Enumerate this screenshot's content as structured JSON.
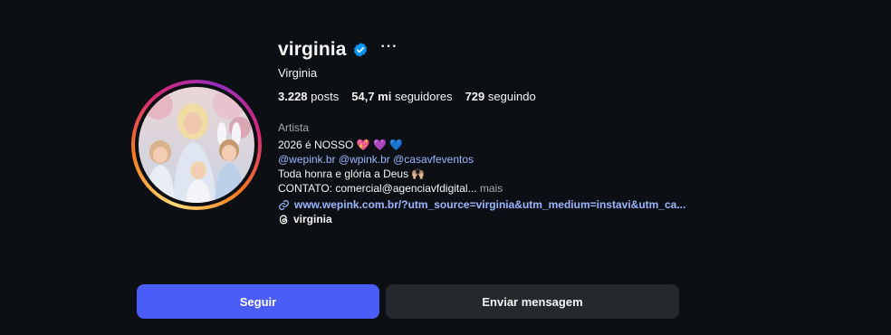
{
  "profile": {
    "username": "virginia",
    "full_name": "Virginia",
    "verified": true,
    "avatar_alt": "virginia"
  },
  "stats": {
    "posts_count": "3.228",
    "posts_label": "posts",
    "followers_count": "54,7 mi",
    "followers_label": "seguidores",
    "following_count": "729",
    "following_label": "seguindo"
  },
  "bio": {
    "category": "Artista",
    "line1": "2026 é NOSSO 💖 💜 💙",
    "mentions": [
      "@wepink.br",
      "@wpink.br",
      "@casavfeventos"
    ],
    "line3": "Toda honra e glória a Deus 🙌🏼",
    "line4": "CONTATO: comercial@agenciavfdigital...",
    "more_label": "mais",
    "link": "www.wepink.com.br/?utm_source=virginia&utm_medium=instavi&utm_ca...",
    "threads_handle": "virginia"
  },
  "actions": {
    "follow_label": "Seguir",
    "message_label": "Enviar mensagem"
  },
  "colors": {
    "background": "#0c1014",
    "follow_button": "#4a5df9",
    "message_button": "#25292e",
    "link": "#9bb6ff",
    "verified": "#0095f6"
  },
  "icons": {
    "verified": "verified-badge-icon",
    "more": "more-options-icon",
    "link": "link-icon",
    "threads": "threads-icon"
  }
}
